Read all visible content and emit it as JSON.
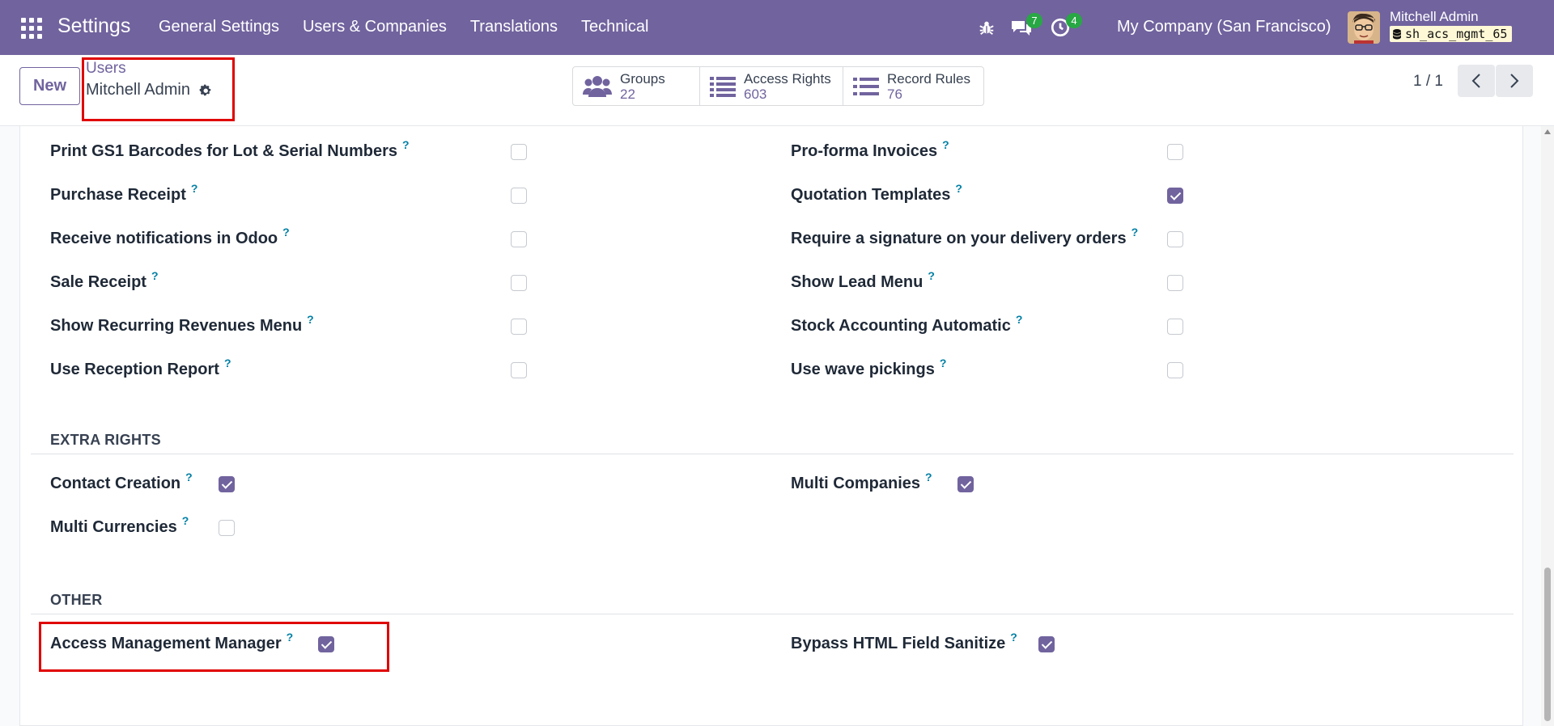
{
  "navbar": {
    "app_name": "Settings",
    "menu": [
      "General Settings",
      "Users & Companies",
      "Translations",
      "Technical"
    ],
    "messages_count": "7",
    "activities_count": "4",
    "company": "My Company (San Francisco)",
    "user": "Mitchell Admin",
    "database": "sh_acs_mgmt_65",
    "brand_color": "#71639e"
  },
  "control": {
    "new_label": "New",
    "breadcrumb_parent": "Users",
    "breadcrumb_current": "Mitchell Admin",
    "smart_buttons": [
      {
        "label": "Groups",
        "value": "22",
        "icon": "users-icon"
      },
      {
        "label": "Access Rights",
        "value": "603",
        "icon": "list-icon"
      },
      {
        "label": "Record Rules",
        "value": "76",
        "icon": "list-icon"
      }
    ],
    "pager": "1 / 1"
  },
  "technical_rows": [
    {
      "left": {
        "label": "Print GS1 Barcodes for Lot & Serial Numbers",
        "checked": false
      },
      "right": {
        "label": "Pro-forma Invoices",
        "checked": false
      }
    },
    {
      "left": {
        "label": "Purchase Receipt",
        "checked": false
      },
      "right": {
        "label": "Quotation Templates",
        "checked": true
      }
    },
    {
      "left": {
        "label": "Receive notifications in Odoo",
        "checked": false
      },
      "right": {
        "label": "Require a signature on your delivery orders",
        "checked": false
      }
    },
    {
      "left": {
        "label": "Sale Receipt",
        "checked": false
      },
      "right": {
        "label": "Show Lead Menu",
        "checked": false
      }
    },
    {
      "left": {
        "label": "Show Recurring Revenues Menu",
        "checked": false
      },
      "right": {
        "label": "Stock Accounting Automatic",
        "checked": false
      }
    },
    {
      "left": {
        "label": "Use Reception Report",
        "checked": false
      },
      "right": {
        "label": "Use wave pickings",
        "checked": false
      }
    }
  ],
  "extra_rights": {
    "title": "EXTRA RIGHTS",
    "items": [
      {
        "label": "Contact Creation",
        "checked": true
      },
      {
        "label": "Multi Companies",
        "checked": true
      },
      {
        "label": "Multi Currencies",
        "checked": false
      }
    ]
  },
  "other": {
    "title": "OTHER",
    "items": [
      {
        "label": "Access Management Manager",
        "checked": true
      },
      {
        "label": "Bypass HTML Field Sanitize",
        "checked": true
      }
    ]
  },
  "tooltip_mark": "?"
}
